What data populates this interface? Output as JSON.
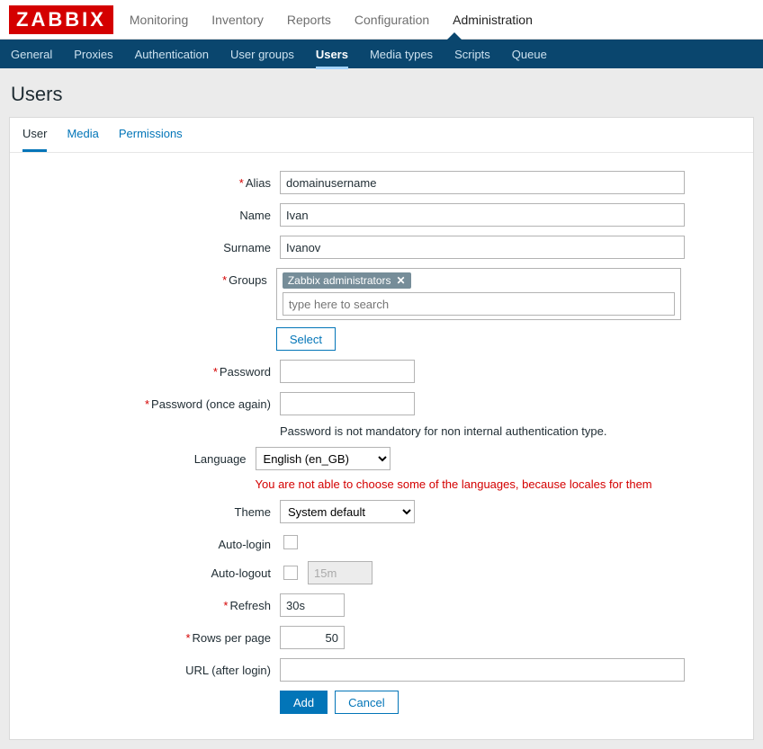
{
  "logo": "ZABBIX",
  "main_nav": {
    "items": [
      "Monitoring",
      "Inventory",
      "Reports",
      "Configuration",
      "Administration"
    ],
    "selected": "Administration"
  },
  "sub_nav": {
    "items": [
      "General",
      "Proxies",
      "Authentication",
      "User groups",
      "Users",
      "Media types",
      "Scripts",
      "Queue"
    ],
    "selected": "Users"
  },
  "page_title": "Users",
  "tabs": {
    "items": [
      "User",
      "Media",
      "Permissions"
    ],
    "selected": "User"
  },
  "form": {
    "alias": {
      "label": "Alias",
      "value": "domainusername",
      "required": true
    },
    "name": {
      "label": "Name",
      "value": "Ivan",
      "required": false
    },
    "surname": {
      "label": "Surname",
      "value": "Ivanov",
      "required": false
    },
    "groups": {
      "label": "Groups",
      "required": true,
      "tags": [
        "Zabbix administrators"
      ],
      "placeholder": "type here to search",
      "select_label": "Select"
    },
    "password": {
      "label": "Password",
      "required": true
    },
    "password2": {
      "label": "Password (once again)",
      "required": true
    },
    "password_note": "Password is not mandatory for non internal authentication type.",
    "language": {
      "label": "Language",
      "value": "English (en_GB)",
      "warn": "You are not able to choose some of the languages, because locales for them"
    },
    "theme": {
      "label": "Theme",
      "value": "System default"
    },
    "autologin": {
      "label": "Auto-login",
      "checked": false
    },
    "autologout": {
      "label": "Auto-logout",
      "checked": false,
      "value": "15m"
    },
    "refresh": {
      "label": "Refresh",
      "value": "30s",
      "required": true
    },
    "rows": {
      "label": "Rows per page",
      "value": "50",
      "required": true
    },
    "url": {
      "label": "URL (after login)",
      "value": ""
    },
    "buttons": {
      "add": "Add",
      "cancel": "Cancel"
    }
  }
}
